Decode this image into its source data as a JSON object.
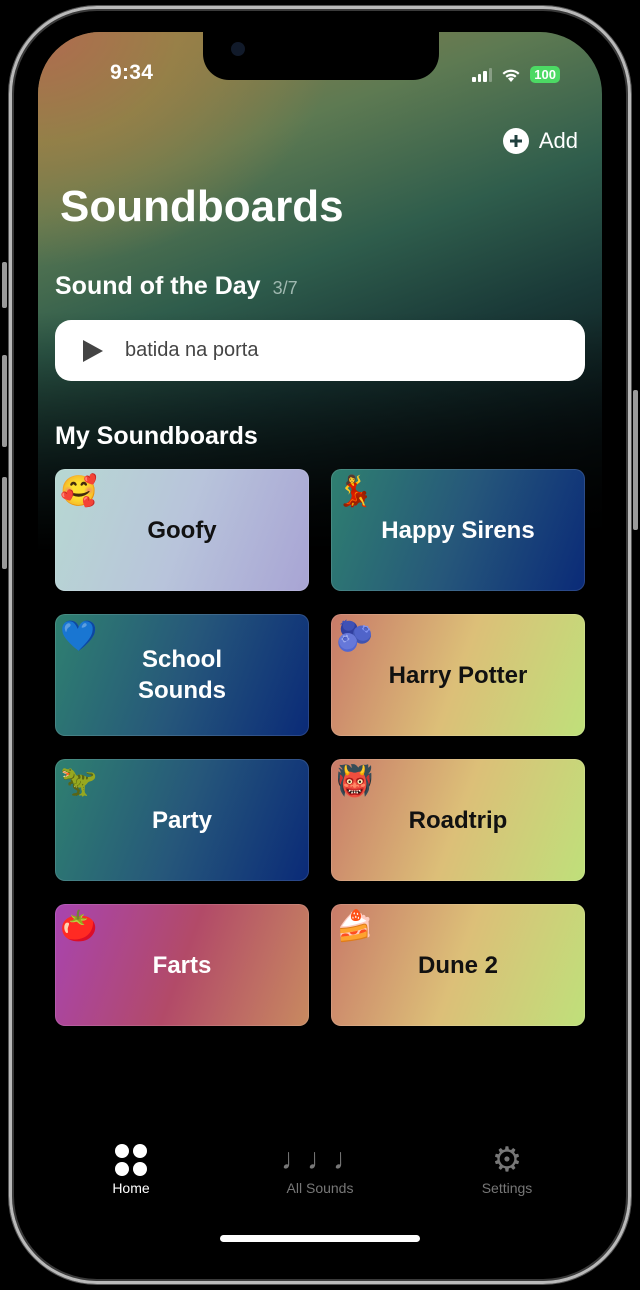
{
  "status_bar": {
    "time": "9:34",
    "battery": "100",
    "icons": [
      "signal-icon",
      "wifi-icon",
      "battery-icon"
    ]
  },
  "header": {
    "add_label": "Add",
    "title": "Soundboards"
  },
  "sound_of_the_day": {
    "title": "Sound of the Day",
    "count": "3/7",
    "sound_name": "batida na porta"
  },
  "my_soundboards": {
    "title": "My Soundboards",
    "boards": [
      {
        "label": "Goofy",
        "emoji": "🥰",
        "text_color": "#111111",
        "gradient": [
          "#b7d8d2",
          "#b8c4db",
          "#a8a4d4"
        ]
      },
      {
        "label": "Happy Sirens",
        "emoji": "💃",
        "text_color": "#ffffff",
        "gradient": [
          "#2f8070",
          "#26577a",
          "#0a2a78"
        ]
      },
      {
        "label": "School Sounds",
        "emoji": "💙",
        "text_color": "#ffffff",
        "gradient": [
          "#2f8070",
          "#26577a",
          "#0a2a78"
        ]
      },
      {
        "label": "Harry Potter",
        "emoji": "🫐",
        "text_color": "#111111",
        "gradient": [
          "#c87a68",
          "#dcbf78",
          "#bfe07a"
        ]
      },
      {
        "label": "Party",
        "emoji": "🦖",
        "text_color": "#ffffff",
        "gradient": [
          "#2f8070",
          "#26577a",
          "#0a2a78"
        ]
      },
      {
        "label": "Roadtrip",
        "emoji": "👹",
        "text_color": "#111111",
        "gradient": [
          "#c87a68",
          "#dcbf78",
          "#bfe07a"
        ]
      },
      {
        "label": "Farts",
        "emoji": "🍅",
        "text_color": "#ffffff",
        "gradient": [
          "#a844b0",
          "#b24a68",
          "#c88a60"
        ]
      },
      {
        "label": "Dune 2",
        "emoji": "🍰",
        "text_color": "#111111",
        "gradient": [
          "#c87a68",
          "#dcbf78",
          "#bfe07a"
        ]
      }
    ]
  },
  "tab_bar": {
    "tabs": [
      {
        "label": "Home",
        "icon": "grid-icon",
        "active": true
      },
      {
        "label": "All Sounds",
        "icon": "music-notes-icon",
        "active": false
      },
      {
        "label": "Settings",
        "icon": "gear-icon",
        "active": false
      }
    ]
  }
}
